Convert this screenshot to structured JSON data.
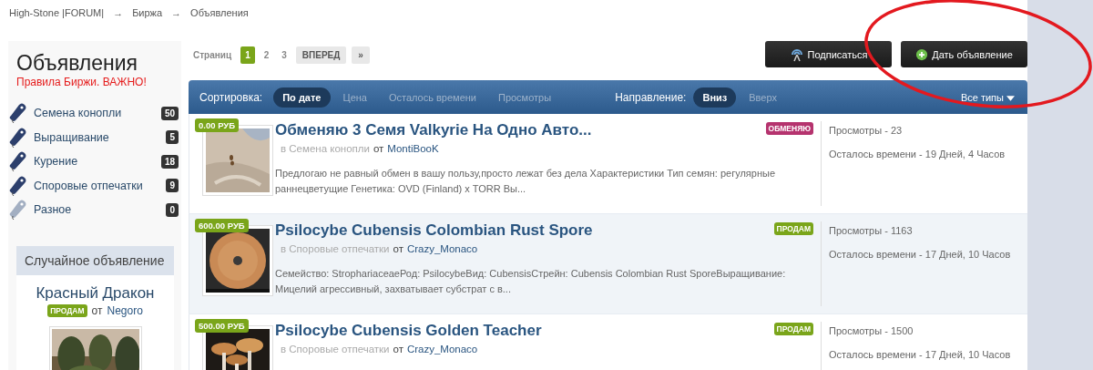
{
  "breadcrumb": {
    "separator": "→",
    "items": [
      {
        "label": "High-Stone |FORUM|"
      },
      {
        "label": "Биржа"
      },
      {
        "label": "Объявления"
      }
    ]
  },
  "sidebar": {
    "title": "Объявления",
    "rules_link": "Правила Биржи. ВАЖНО!",
    "categories": [
      {
        "name": "Семена конопли",
        "count": "50",
        "muted": false
      },
      {
        "name": "Выращивание",
        "count": "5",
        "muted": false
      },
      {
        "name": "Курение",
        "count": "18",
        "muted": false
      },
      {
        "name": "Споровые отпечатки",
        "count": "9",
        "muted": false
      },
      {
        "name": "Разное",
        "count": "0",
        "muted": true
      }
    ],
    "random_ad": {
      "header": "Случайное объявление",
      "title": "Красный Дракон",
      "tag": {
        "label": "ПРОДАМ",
        "color": "#7aa51a"
      },
      "by": "от",
      "author": "Negoro"
    }
  },
  "pagination": {
    "label": "Страниц",
    "pages": [
      {
        "label": "1",
        "selected": true
      },
      {
        "label": "2",
        "selected": false
      },
      {
        "label": "3",
        "selected": false
      }
    ],
    "next": "ВПЕРЕД",
    "last": "»"
  },
  "buttons": [
    {
      "label": "Подписаться",
      "kind": "subscribe"
    },
    {
      "label": "Дать объявление",
      "kind": "add"
    }
  ],
  "sort_bar": {
    "label": "Сортировка:",
    "options": [
      {
        "label": "По дате",
        "selected": true
      },
      {
        "label": "Цена",
        "selected": false
      },
      {
        "label": "Осталось времени",
        "selected": false
      },
      {
        "label": "Просмотры",
        "selected": false
      }
    ],
    "direction_label": "Направление:",
    "directions": [
      {
        "label": "Вниз",
        "selected": true
      },
      {
        "label": "Вверх",
        "selected": false
      }
    ],
    "type_filter": "Все типы"
  },
  "listings": [
    {
      "price": "0.00 РУБ",
      "title": "Обменяю 3 Семя Valkyrie На Одно Авто...",
      "category": "в Семена конопли",
      "by": "от",
      "author": "MontiBooK",
      "description": "Предлогаю не равный обмен в вашу пользу,просто лежат без дела Характеристики Тип семян: регулярные раннецветущие Генетика: OVD (Finland) x TORR Вы...",
      "tag": {
        "label": "ОБМЕНЯЮ",
        "color": "#b5336e"
      },
      "views": "Просмотры - 23",
      "time_left": "Осталось времени - 19 Дней, 4 Часов",
      "highlighted": false
    },
    {
      "price": "600.00 РУБ",
      "title": "Psilocybe Cubensis Colombian Rust Spore",
      "category": "в Споровые отпечатки",
      "by": "от",
      "author": "Crazy_Monaco",
      "description": "Семейство: StrophariaceaeРод: PsilocybeВид: CubensisСтрейн: Cubensis Colombian Rust SporeВыращивание: Мицелий агрессивный, захватывает субстрат с в...",
      "tag": {
        "label": "ПРОДАМ",
        "color": "#7aa51a"
      },
      "views": "Просмотры - 1163",
      "time_left": "Осталось времени - 17 Дней, 10 Часов",
      "highlighted": true
    },
    {
      "price": "500.00 РУБ",
      "title": "Psilocybe Cubensis Golden Teacher",
      "category": "в Споровые отпечатки",
      "by": "от",
      "author": "Crazy_Monaco",
      "tag": {
        "label": "ПРОДАМ",
        "color": "#7aa51a"
      },
      "views": "Просмотры - 1500",
      "time_left": "Осталось времени - 17 Дней, 10 Часов",
      "highlighted": false
    }
  ],
  "annotation": {
    "kind": "ellipse"
  }
}
